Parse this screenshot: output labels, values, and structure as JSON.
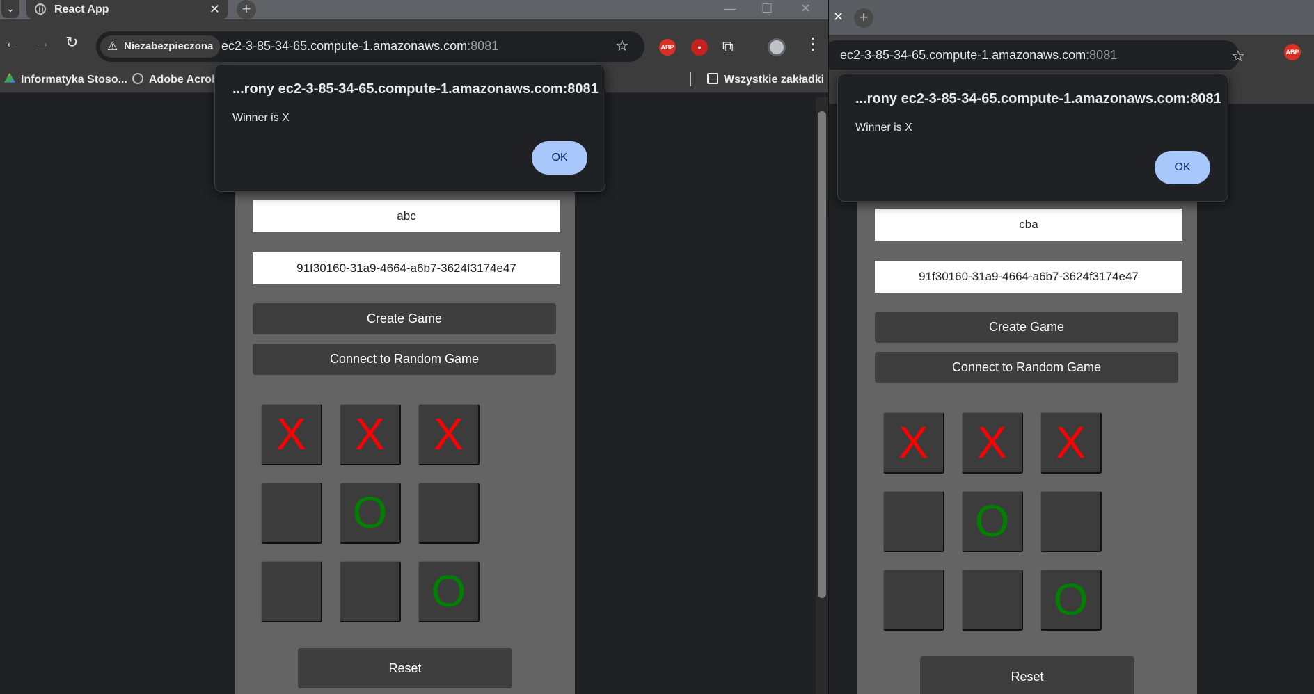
{
  "left_window": {
    "tab_title": "React App",
    "security_chip": "Niezabezpieczona",
    "url_host": "ec2-3-85-34-65.compute-1.amazonaws.com",
    "url_port": ":8081",
    "bookmarks": [
      "Informatyka Stoso...",
      "Adobe Acrobat",
      "Wszystkie zakładki"
    ],
    "extension_abp": "ABP",
    "dialog": {
      "title": "...rony ec2-3-85-34-65.compute-1.amazonaws.com:8081",
      "message": "Winner is X",
      "ok": "OK"
    },
    "app": {
      "player_name": "abc",
      "game_id": "91f30160-31a9-4664-a6b7-3624f3174e47",
      "create_button": "Create Game",
      "connect_button": "Connect to Random Game",
      "board": [
        "X",
        "X",
        "X",
        "",
        "O",
        "",
        "",
        "",
        "O"
      ],
      "reset_button": "Reset"
    }
  },
  "right_window": {
    "url_host": "ec2-3-85-34-65.compute-1.amazonaws.com",
    "url_port": ":8081",
    "extension_abp": "ABP",
    "dialog": {
      "title": "...rony ec2-3-85-34-65.compute-1.amazonaws.com:8081",
      "message": "Winner is X",
      "ok": "OK"
    },
    "app": {
      "player_name": "cba",
      "game_id": "91f30160-31a9-4664-a6b7-3624f3174e47",
      "create_button": "Create Game",
      "connect_button": "Connect to Random Game",
      "board": [
        "X",
        "X",
        "X",
        "",
        "O",
        "",
        "",
        "",
        "O"
      ],
      "reset_button": "Reset"
    }
  },
  "colors": {
    "x_mark": "#ff0000",
    "o_mark": "#008000",
    "ok_button": "#a8c7fa",
    "panel": "#646464"
  }
}
